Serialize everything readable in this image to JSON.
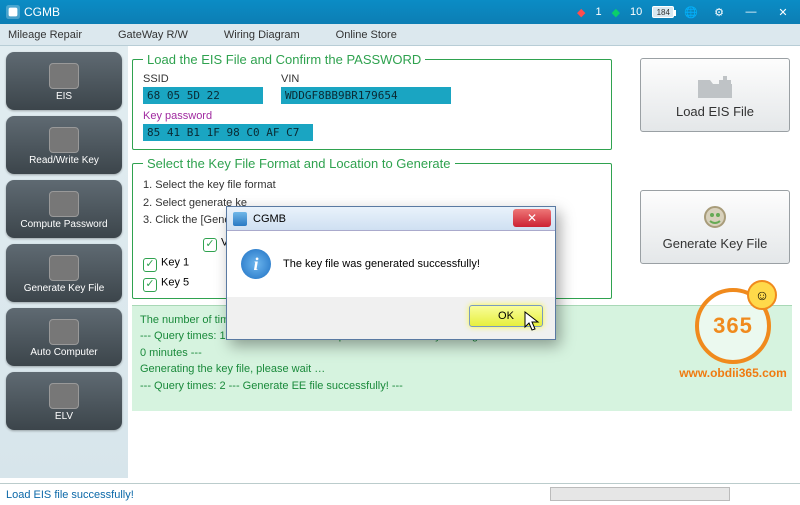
{
  "title": "CGMB",
  "titlebar": {
    "gem_red_count": "1",
    "gem_green_count": "10",
    "battery": "184"
  },
  "menu": {
    "mileage": "Mileage Repair",
    "gateway": "GateWay R/W",
    "wiring": "Wiring Diagram",
    "store": "Online Store"
  },
  "sidebar": {
    "items": [
      {
        "label": "EIS"
      },
      {
        "label": "Read/Write Key"
      },
      {
        "label": "Compute Password"
      },
      {
        "label": "Generate Key File"
      },
      {
        "label": "Auto Computer"
      },
      {
        "label": "ELV"
      }
    ]
  },
  "box1": {
    "legend": "Load the EIS File and Confirm the PASSWORD",
    "ssid_label": "SSID",
    "ssid_value": "68 05 5D 22",
    "vin_label": "VIN",
    "vin_value": "WDDGF8BB9BR179654",
    "keypw_label": "Key password",
    "keypw_value": "85 41 B1 1F 98 C0 AF C7"
  },
  "box2": {
    "legend": "Select the Key File Format and Location to Generate",
    "step1": "1. Select the key file format",
    "step2": "2. Select generate ke",
    "step3": "3. Click the [Generat",
    "v04": "V04",
    "k1": "Key 1",
    "k5": "Key 5"
  },
  "right_buttons": {
    "load": "Load EIS File",
    "gen": "Generate Key File"
  },
  "log": {
    "l1": "The number of times remaining for calculate EE today: 10",
    "l2": "--- Query times: 1 --- Current number of queues: 0 ---Probably waiting time:",
    "l3": " 0 minutes ---",
    "l4": "Generating the key file, please wait …",
    "l5": "--- Query times: 2 --- Generate EE file successfully! ---"
  },
  "status": "Load EIS file successfully!",
  "dialog": {
    "title": "CGMB",
    "msg": "The key file was generated successfully!",
    "ok": "OK"
  },
  "watermark": {
    "num": "365",
    "url": "www.obdii365.com"
  }
}
